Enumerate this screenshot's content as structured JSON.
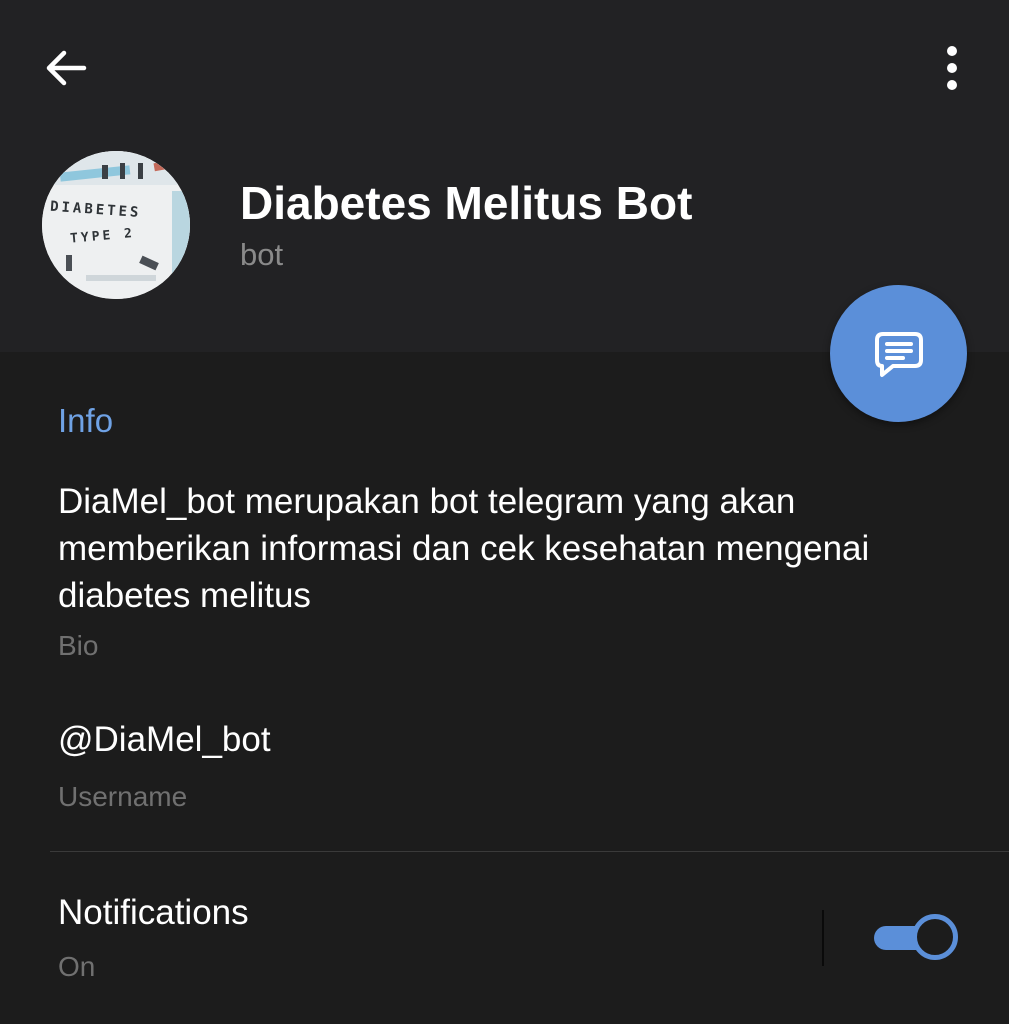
{
  "toolbar": {
    "back_icon": "arrow-left-icon",
    "more_icon": "more-vertical-icon"
  },
  "profile": {
    "name": "Diabetes Melitus Bot",
    "status": "bot",
    "avatar_text_line1": "DIABETES",
    "avatar_text_line2": "TYPE 2"
  },
  "fab": {
    "icon": "message-icon"
  },
  "info": {
    "section_title": "Info",
    "bio": "DiaMel_bot merupakan bot telegram yang akan memberikan informasi dan cek kesehatan mengenai diabetes melitus",
    "bio_caption": "Bio",
    "username": "@DiaMel_bot",
    "username_caption": "Username"
  },
  "notifications": {
    "label": "Notifications",
    "state": "On",
    "enabled": true
  },
  "colors": {
    "accent": "#5b8fd9",
    "section_title": "#6fa2e5",
    "header_bg": "#222224",
    "body_bg": "#1c1c1c"
  }
}
